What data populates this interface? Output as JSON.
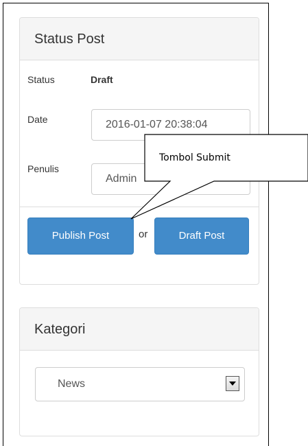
{
  "status_panel": {
    "title": "Status Post",
    "status_label": "Status",
    "status_value": "Draft",
    "date_label": "Date",
    "date_value": "2016-01-07 20:38:04",
    "author_label": "Penulis",
    "author_value": "Admin",
    "publish_button": "Publish Post",
    "or_text": "or",
    "draft_button": "Draft Post"
  },
  "category_panel": {
    "title": "Kategori",
    "selected_option": "News"
  },
  "annotation": {
    "callout_text": "Tombol Submit"
  },
  "colors": {
    "primary_button": "#428bca",
    "panel_heading_bg": "#f5f5f5",
    "border": "#dddddd"
  },
  "icons": {
    "select_arrow": "triangle-down-icon"
  }
}
